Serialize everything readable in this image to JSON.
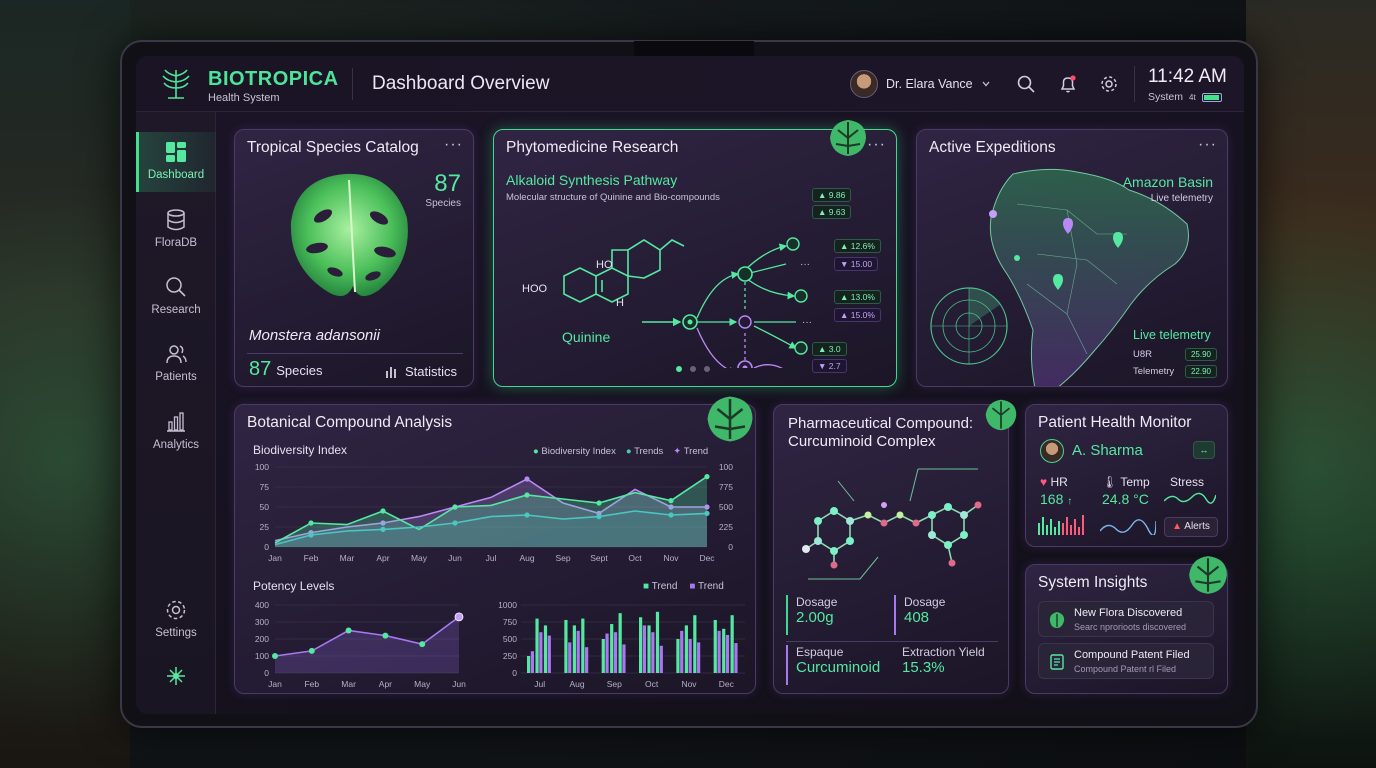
{
  "app": {
    "brand_title": "BIOTROPICA",
    "brand_subtitle": "Health System",
    "page_title": "Dashboard Overview"
  },
  "topbar": {
    "user_name": "Dr. Elara Vance",
    "clock": "11:42 AM",
    "system_label": "System",
    "system_signal": "4t"
  },
  "sidebar": {
    "items": [
      {
        "label": "Dashboard",
        "icon": "grid-icon",
        "active": true
      },
      {
        "label": "FloraDB",
        "icon": "database-icon",
        "active": false
      },
      {
        "label": "Research",
        "icon": "search-icon",
        "active": false
      },
      {
        "label": "Patients",
        "icon": "users-icon",
        "active": false
      },
      {
        "label": "Analytics",
        "icon": "bar-chart-icon",
        "active": false
      }
    ],
    "settings_label": "Settings"
  },
  "species_catalog": {
    "title": "Tropical Species Catalog",
    "count": "87",
    "count_label": "Species",
    "species_name": "Monstera adansonii",
    "footer_count": "87",
    "footer_label": "Species",
    "stats_label": "Statistics"
  },
  "phytomedicine": {
    "title": "Phytomedicine Research",
    "subtitle": "Alkaloid Synthesis Pathway",
    "description": "Molecular structure of Quinine and Bio-compounds",
    "molecule_name": "Quinine",
    "atom_ho": "HO",
    "atom_h": "H",
    "atom_hoo": "HOO",
    "values": [
      {
        "up": "▲ 9.86",
        "down": "▲ 9.63"
      },
      {
        "up": "▲ 12.6%",
        "down": "▼ 15.00"
      },
      {
        "up": "▲ 13.0%",
        "down": "▲ 15.0%"
      },
      {
        "up": "▲ 3.0",
        "down": "▼ 2.7"
      }
    ]
  },
  "expeditions": {
    "title": "Active Expeditions",
    "region": "Amazon Basin",
    "region_sub": "Live telemetry",
    "telemetry_title": "Live telemetry",
    "rows": [
      {
        "label": "U8R",
        "value": "25.90"
      },
      {
        "label": "Telemetry",
        "value": "22.90"
      }
    ]
  },
  "compound_analysis": {
    "title": "Botanical Compound Analysis",
    "biodiversity": {
      "title": "Biodiversity Index",
      "legend": [
        "Biodiversity Index",
        "Trends",
        "Trend"
      ],
      "y_left": [
        "100",
        "75",
        "50",
        "25",
        "0"
      ],
      "y_right": [
        "100",
        "775",
        "500",
        "225",
        "0"
      ],
      "x_labels": [
        "Jan",
        "Feb",
        "Mar",
        "Apr",
        "May",
        "Jun",
        "Jul",
        "Aug",
        "Sep",
        "Sept",
        "Oct",
        "Nov",
        "Dec"
      ]
    },
    "potency": {
      "title": "Potency Levels",
      "y_labels": [
        "400",
        "300",
        "200",
        "100",
        "0"
      ],
      "x_labels": [
        "Jan",
        "Feb",
        "Mar",
        "Apr",
        "May",
        "Jun"
      ]
    },
    "bars": {
      "legend": [
        "Trend",
        "Trend"
      ],
      "y_labels": [
        "1000",
        "750",
        "500",
        "250",
        "0"
      ],
      "x_labels": [
        "Jul",
        "Aug",
        "Sep",
        "Oct",
        "Nov",
        "Dec"
      ]
    }
  },
  "chart_data": [
    {
      "type": "area",
      "title": "Biodiversity Index",
      "categories": [
        "Jan",
        "Feb",
        "Mar",
        "Apr",
        "May",
        "Jun",
        "Jul",
        "Aug",
        "Sep",
        "Sept",
        "Oct",
        "Nov",
        "Dec"
      ],
      "ylim": [
        0,
        100
      ],
      "series": [
        {
          "name": "Biodiversity Index",
          "values": [
            5,
            30,
            28,
            45,
            22,
            50,
            52,
            65,
            60,
            55,
            68,
            58,
            88
          ]
        },
        {
          "name": "Trends",
          "values": [
            3,
            15,
            20,
            22,
            25,
            30,
            38,
            40,
            35,
            38,
            45,
            40,
            42
          ]
        },
        {
          "name": "Trend",
          "values": [
            8,
            18,
            25,
            30,
            38,
            50,
            62,
            85,
            55,
            42,
            72,
            50,
            50
          ]
        }
      ]
    },
    {
      "type": "line",
      "title": "Potency Levels",
      "categories": [
        "Jan",
        "Feb",
        "Mar",
        "Apr",
        "May",
        "Jun"
      ],
      "ylim": [
        0,
        400
      ],
      "series": [
        {
          "name": "",
          "values": [
            100,
            130,
            250,
            220,
            170,
            330
          ]
        }
      ]
    },
    {
      "type": "bar",
      "title": "",
      "categories": [
        "Jul",
        "Aug",
        "Sep",
        "Oct",
        "Nov",
        "Dec"
      ],
      "ylim": [
        0,
        1000
      ],
      "series": [
        {
          "name": "Trend",
          "values": [
            250,
            800,
            700,
            780,
            700,
            800,
            500,
            720,
            880,
            820,
            700,
            900,
            500,
            700,
            850,
            780,
            650,
            850
          ]
        },
        {
          "name": "Trend",
          "values": [
            320,
            600,
            550,
            450,
            620,
            380,
            580,
            600,
            420,
            700,
            600,
            400,
            620,
            500,
            450,
            620,
            560,
            440
          ]
        }
      ]
    }
  ],
  "pharma": {
    "title_line1": "Pharmaceutical Compound:",
    "title_line2": "Curcuminoid Complex",
    "metrics": [
      {
        "label": "Dosage",
        "value": "2.00g"
      },
      {
        "label": "Dosage",
        "value": "408"
      },
      {
        "label": "Espaque",
        "value": "Curcuminoid"
      },
      {
        "label": "Extraction Yield",
        "value": "15.3%"
      }
    ]
  },
  "patient_monitor": {
    "title": "Patient Health Monitor",
    "patient_name": "A. Sharma",
    "hr_label": "HR",
    "hr_value": "168",
    "temp_label": "Temp",
    "temp_value": "24.8 °C",
    "stress_label": "Stress",
    "alerts_label": "Alerts"
  },
  "insights": {
    "title": "System Insights",
    "items": [
      {
        "title": "New Flora Discovered",
        "sub": "Searc nprorioots discovered"
      },
      {
        "title": "Compound Patent Filed",
        "sub": "Compound Patent rl Filed"
      }
    ]
  },
  "colors": {
    "accent_green": "#44e08e",
    "accent_violet": "#a978f0",
    "background": "#161220"
  }
}
